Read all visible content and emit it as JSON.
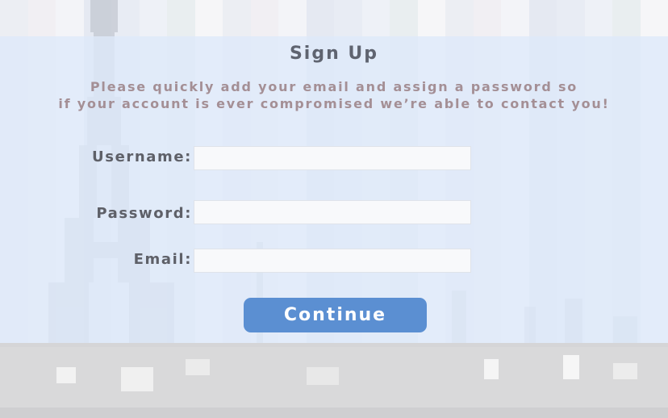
{
  "form": {
    "title": "Sign Up",
    "subtitle": "Please quickly add your email and assign a password so\nif your account is ever compromised we’re able to contact you!",
    "fields": [
      {
        "label": "Username:",
        "value": "",
        "placeholder": ""
      },
      {
        "label": "Password:",
        "value": "",
        "placeholder": ""
      },
      {
        "label": "Email:",
        "value": "",
        "placeholder": ""
      }
    ],
    "continue_label": "Continue"
  },
  "colors": {
    "button": "#5b8fd2",
    "title": "#5f6470",
    "subtitle": "#a48f95",
    "panel": "#dee9fa"
  }
}
